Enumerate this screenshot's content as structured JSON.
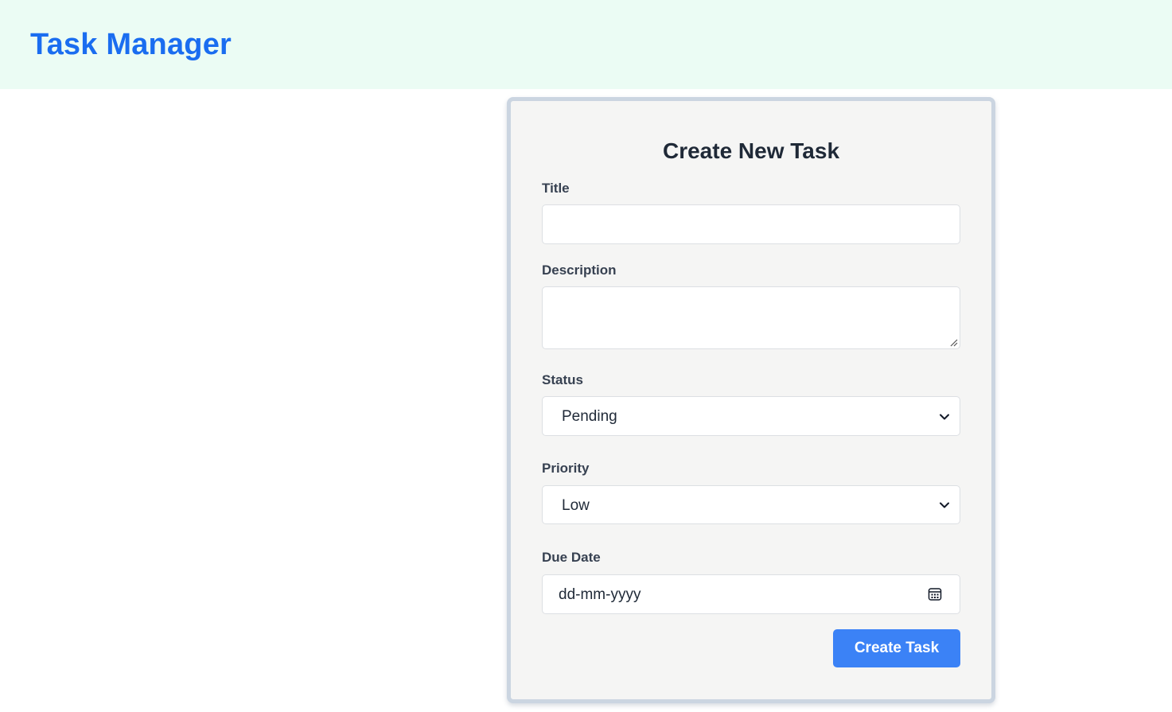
{
  "header": {
    "app_title": "Task Manager",
    "background": "#ebfcf4",
    "title_color": "#1a6df0"
  },
  "form": {
    "title": "Create New Task",
    "fields": {
      "title": {
        "label": "Title",
        "value": ""
      },
      "description": {
        "label": "Description",
        "value": ""
      },
      "status": {
        "label": "Status",
        "selected": "Pending"
      },
      "priority": {
        "label": "Priority",
        "selected": "Low"
      },
      "due_date": {
        "label": "Due Date",
        "placeholder": "dd-mm-yyyy"
      }
    },
    "submit_label": "Create Task",
    "submit_color": "#3b82f6"
  },
  "icons": {
    "status_select": "chevron-down-icon",
    "priority_select": "chevron-down-icon",
    "due_date": "calendar-icon",
    "description": "resize-grip-icon"
  }
}
